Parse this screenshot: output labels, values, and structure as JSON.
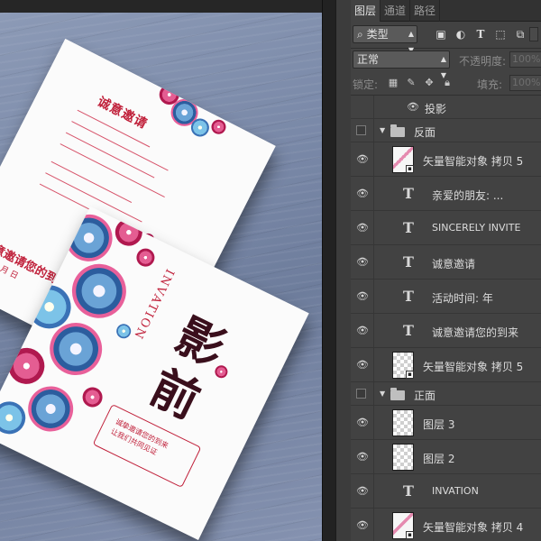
{
  "canvas": {
    "back_card": {
      "title": "诚意邀请",
      "invite_line": "诚意邀请您的到来",
      "date_line": "年 月 日"
    },
    "front_card": {
      "invation": "INVATION",
      "calligraphy": [
        "影",
        "前"
      ],
      "message_lines": [
        "诚挚邀请您的到来",
        "让我们共同见证"
      ]
    }
  },
  "panel": {
    "tabs": [
      "图层",
      "通道",
      "路径"
    ],
    "active_tab": 0,
    "filter": {
      "label": "类型",
      "icon": "search-icon"
    },
    "blend_mode": "正常",
    "opacity_label": "不透明度:",
    "opacity_value": "100%",
    "lock_label": "锁定:",
    "fill_label": "填充:",
    "fill_value": "100%",
    "effect_row": "投影",
    "layers": [
      {
        "kind": "group",
        "name": "反面",
        "visible": false
      },
      {
        "kind": "smart",
        "name": "矢量智能对象 拷贝 5",
        "visible": true
      },
      {
        "kind": "text",
        "name": "亲爱的朋友:    ...",
        "visible": true
      },
      {
        "kind": "text",
        "name": "SINCERELY INVITE",
        "visible": true
      },
      {
        "kind": "text",
        "name": "诚意邀请",
        "visible": true
      },
      {
        "kind": "text",
        "name": "活动时间:   年",
        "visible": true
      },
      {
        "kind": "text",
        "name": "诚意邀请您的到来",
        "visible": true
      },
      {
        "kind": "smart",
        "name": "矢量智能对象 拷贝 5",
        "visible": true
      },
      {
        "kind": "group",
        "name": "正面",
        "visible": false
      },
      {
        "kind": "raster",
        "name": "图层 3",
        "visible": true
      },
      {
        "kind": "raster",
        "name": "图层 2",
        "visible": true
      },
      {
        "kind": "text",
        "name": "INVATION",
        "visible": true
      },
      {
        "kind": "smart",
        "name": "矢量智能对象 拷贝 4",
        "visible": true
      }
    ]
  }
}
